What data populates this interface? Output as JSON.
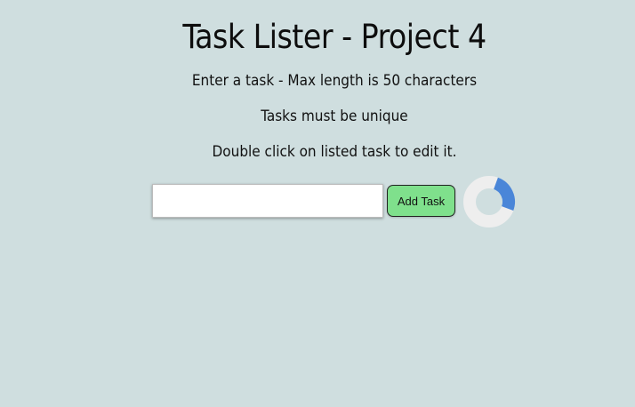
{
  "header": {
    "title": "Task Lister - Project 4"
  },
  "instructions": {
    "line1": "Enter a task - Max length is 50 characters",
    "line2": "Tasks must be unique",
    "line3": "Double click on listed task to edit it."
  },
  "form": {
    "input_value": "",
    "input_placeholder": "",
    "add_button_label": "Add Task"
  },
  "spinner": {
    "icon": "loading-spinner-icon",
    "track_color": "#eeeeee",
    "arc_color": "#4a86d8",
    "arc_fraction": 0.25
  },
  "colors": {
    "background": "#cfdedf",
    "button": "#7fe08c"
  }
}
